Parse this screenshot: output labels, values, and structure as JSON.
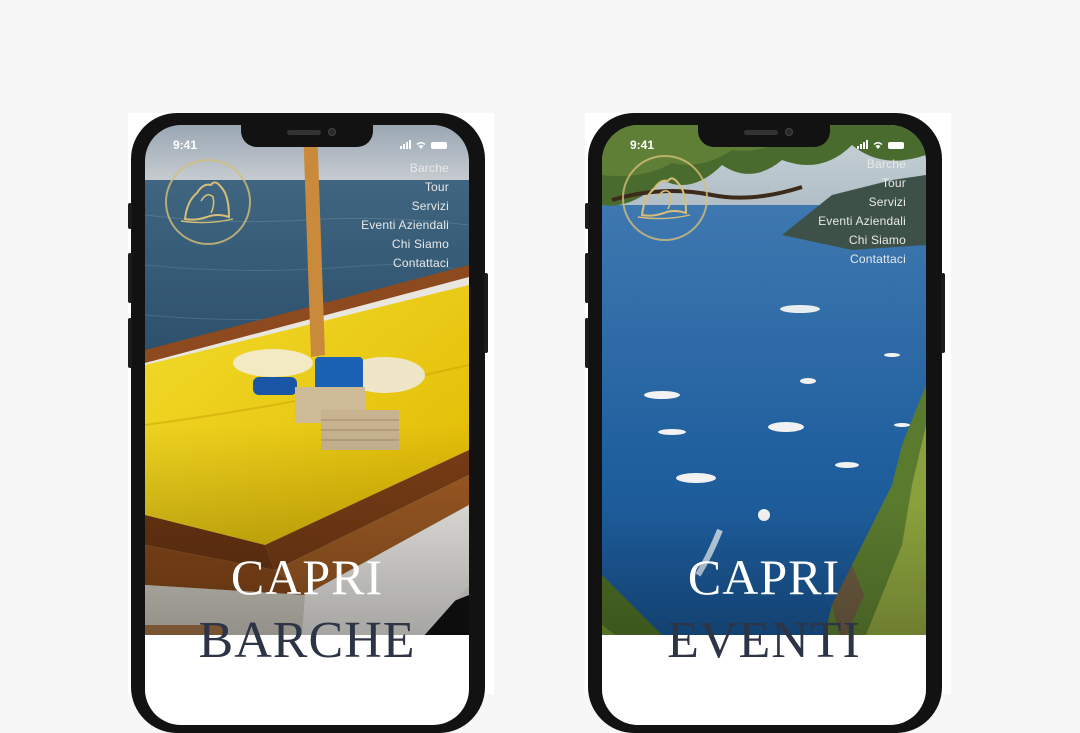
{
  "status_time": "9:41",
  "menu": [
    "Barche",
    "Tour",
    "Servizi",
    "Eventi Aziendali",
    "Chi Siamo",
    "Contattaci"
  ],
  "left_phone": {
    "title_top": "CAPRI",
    "title_bottom": "BARCHE"
  },
  "right_phone": {
    "title_top": "CAPRI",
    "title_bottom": "EVENTI"
  },
  "colors": {
    "background": "#f7f7f7",
    "title_dark": "#2c3446",
    "logo_gold": "#d6be78",
    "sea": "#1f5f9e",
    "deck_yellow": "#f5d400"
  }
}
